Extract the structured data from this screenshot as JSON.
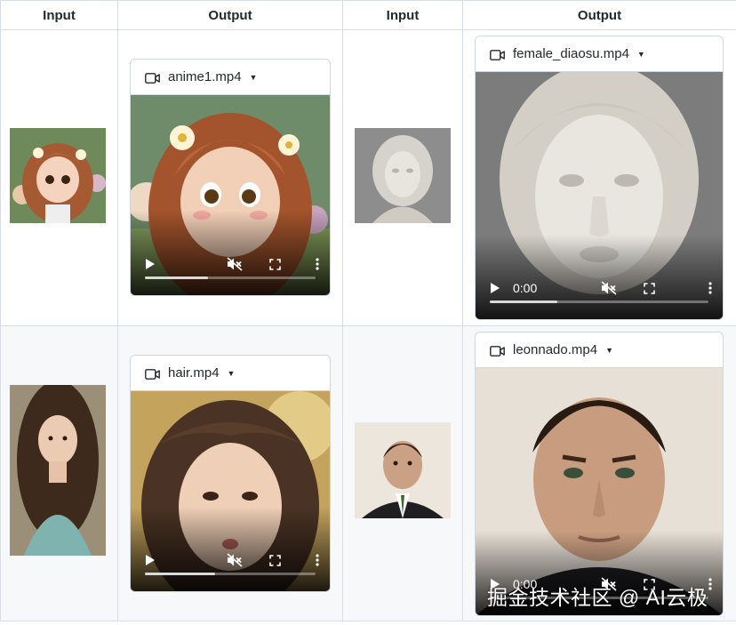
{
  "table": {
    "headers": [
      "Input",
      "Output",
      "Input",
      "Output"
    ]
  },
  "examples": [
    {
      "input_alt": "anime girl portrait",
      "video": {
        "filename": "anime1.mp4",
        "time": "",
        "progress": 0.37
      }
    },
    {
      "input_alt": "marble statue portrait",
      "video": {
        "filename": "female_diaosu.mp4",
        "time": "0:00",
        "progress": 0.31
      }
    },
    {
      "input_alt": "long hair woman portrait",
      "video": {
        "filename": "hair.mp4",
        "time": "",
        "progress": 0.41
      }
    },
    {
      "input_alt": "man in suit portrait",
      "video": {
        "filename": "leonnado.mp4",
        "time": "0:00",
        "progress": 0.0
      }
    }
  ],
  "watermark": {
    "text": "掘金技术社区 @ AI云极"
  },
  "icons": {
    "header": "video-camera-icon",
    "menu": "caret-down-icon",
    "play": "play-icon",
    "mute": "mute-icon",
    "fullscreen": "fullscreen-icon",
    "more": "more-vertical-icon"
  },
  "colors": {
    "border": "#d8dee4",
    "row_alt": "#f6f8fa",
    "text": "#24292f"
  }
}
